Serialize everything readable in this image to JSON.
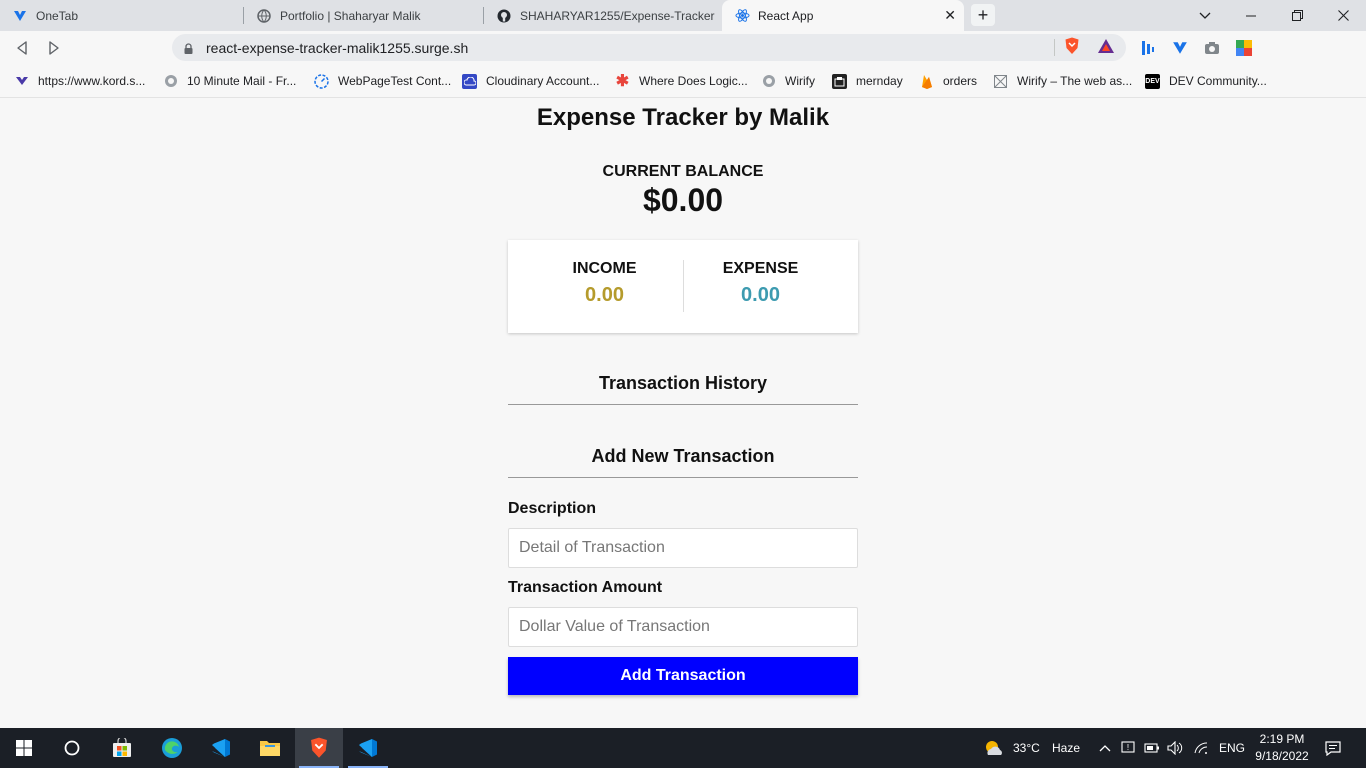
{
  "browser": {
    "tabs": [
      {
        "title": "OneTab",
        "icon": "onetab-icon",
        "active": false
      },
      {
        "title": "Portfolio | Shaharyar Malik",
        "icon": "globe-icon",
        "active": false
      },
      {
        "title": "SHAHARYAR1255/Expense-Tracker",
        "icon": "github-icon",
        "active": false
      },
      {
        "title": "React App",
        "icon": "react-icon",
        "active": true
      }
    ],
    "close_glyph": "✕",
    "new_tab_glyph": "+",
    "url": "react-expense-tracker-malik1255.surge.sh",
    "bookmarks": [
      {
        "label": "https://www.kord.s...",
        "icon": "kord-icon"
      },
      {
        "label": "10 Minute Mail - Fr...",
        "icon": "mail-icon"
      },
      {
        "label": "WebPageTest Cont...",
        "icon": "webpagetest-icon"
      },
      {
        "label": "Cloudinary Account...",
        "icon": "cloudinary-icon"
      },
      {
        "label": "Where Does Logic...",
        "icon": "asterisk-icon"
      },
      {
        "label": "Wirify",
        "icon": "globe-icon"
      },
      {
        "label": "mernday",
        "icon": "mernday-icon"
      },
      {
        "label": "orders",
        "icon": "firebase-icon"
      },
      {
        "label": "Wirify – The web as...",
        "icon": "wirify-icon"
      },
      {
        "label": "DEV Community...",
        "icon": "dev-icon"
      }
    ]
  },
  "app": {
    "title": "Expense Tracker by Malik",
    "balance_label": "CURRENT BALANCE",
    "balance_value": "$0.00",
    "income_label": "INCOME",
    "income_value": "0.00",
    "expense_label": "EXPENSE",
    "expense_value": "0.00",
    "history_heading": "Transaction History",
    "add_heading": "Add New Transaction",
    "description_label": "Description",
    "description_placeholder": "Detail of Transaction",
    "description_value": "",
    "amount_label": "Transaction Amount",
    "amount_placeholder": "Dollar Value of Transaction",
    "amount_value": "",
    "add_button": "Add Transaction"
  },
  "colors": {
    "income": "#b59b2c",
    "expense": "#3d9bb0",
    "button": "#0000ff"
  },
  "taskbar": {
    "weather_temp": "33°C",
    "weather_desc": "Haze",
    "language": "ENG",
    "time": "2:19 PM",
    "date": "9/18/2022"
  }
}
